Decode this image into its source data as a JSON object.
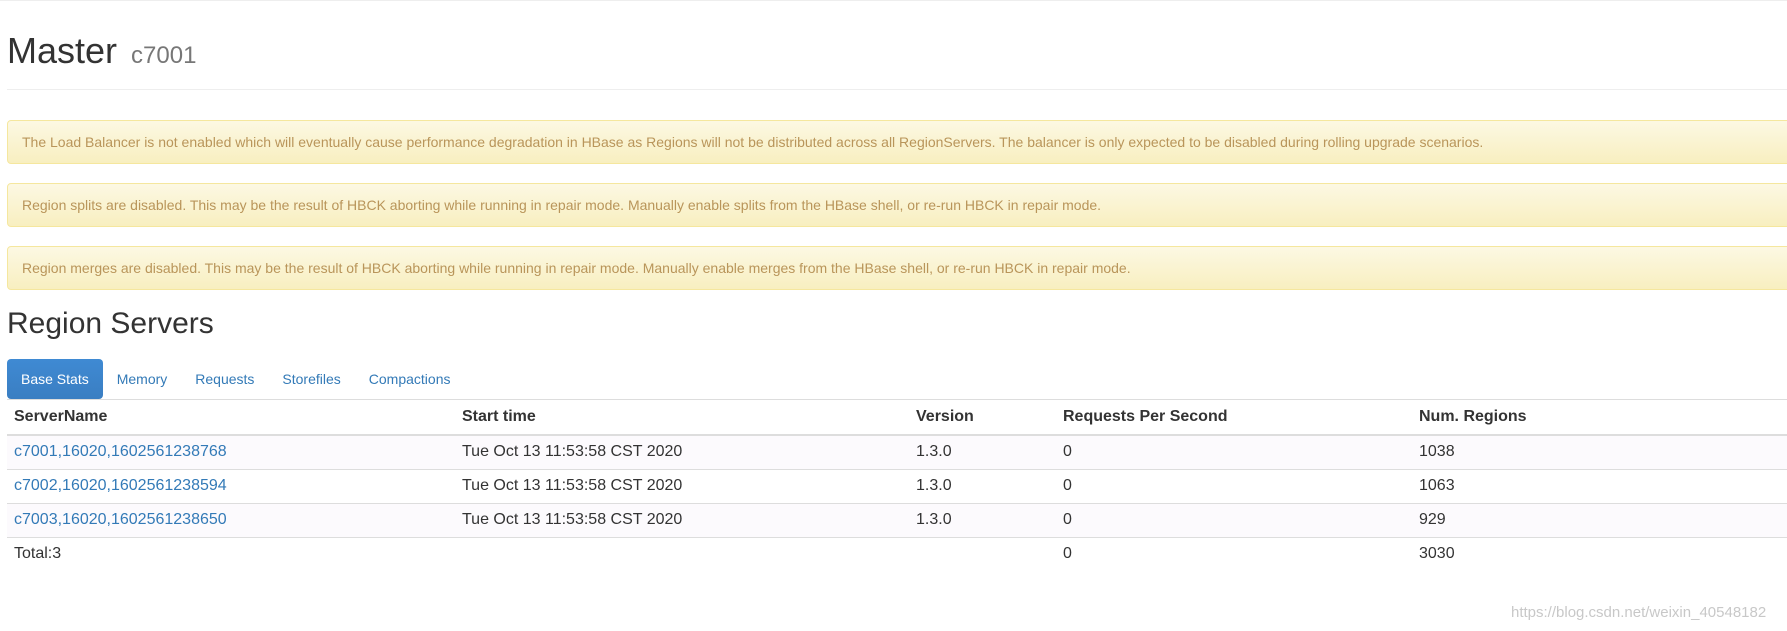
{
  "header": {
    "title": "Master",
    "subtitle": "c7001"
  },
  "alerts": [
    "The Load Balancer is not enabled which will eventually cause performance degradation in HBase as Regions will not be distributed across all RegionServers. The balancer is only expected to be disabled during rolling upgrade scenarios.",
    "Region splits are disabled. This may be the result of HBCK aborting while running in repair mode. Manually enable splits from the HBase shell, or re-run HBCK in repair mode.",
    "Region merges are disabled. This may be the result of HBCK aborting while running in repair mode. Manually enable merges from the HBase shell, or re-run HBCK in repair mode."
  ],
  "region_servers": {
    "title": "Region Servers",
    "tabs": [
      "Base Stats",
      "Memory",
      "Requests",
      "Storefiles",
      "Compactions"
    ],
    "active_tab": "Base Stats",
    "columns": [
      "ServerName",
      "Start time",
      "Version",
      "Requests Per Second",
      "Num. Regions"
    ],
    "rows": [
      {
        "server": "c7001,16020,1602561238768",
        "start": "Tue Oct 13 11:53:58 CST 2020",
        "version": "1.3.0",
        "rps": "0",
        "regions": "1038"
      },
      {
        "server": "c7002,16020,1602561238594",
        "start": "Tue Oct 13 11:53:58 CST 2020",
        "version": "1.3.0",
        "rps": "0",
        "regions": "1063"
      },
      {
        "server": "c7003,16020,1602561238650",
        "start": "Tue Oct 13 11:53:58 CST 2020",
        "version": "1.3.0",
        "rps": "0",
        "regions": "929"
      }
    ],
    "total": {
      "label": "Total:3",
      "rps": "0",
      "regions": "3030"
    }
  },
  "watermark": "https://blog.csdn.net/weixin_40548182",
  "colors": {
    "link": "#337ab7",
    "active_tab": "#428bca",
    "alert_background": "#fcf8e3",
    "alert_text": "#c09853"
  }
}
